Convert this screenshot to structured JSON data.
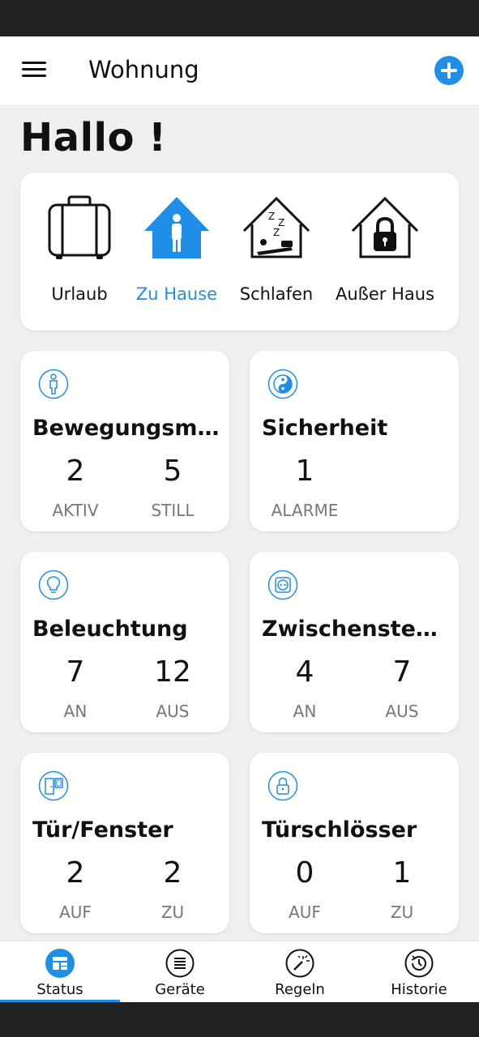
{
  "header": {
    "title": "Wohnung",
    "menu_icon": "hamburger-menu-icon",
    "add_icon": "plus-circle-icon",
    "accent_color": "#1f8ee6"
  },
  "greeting": "Hallo !",
  "modes": [
    {
      "label": "Urlaub",
      "icon": "suitcase-icon",
      "active": false
    },
    {
      "label": "Zu Hause",
      "icon": "home-person-icon",
      "active": true
    },
    {
      "label": "Schlafen",
      "icon": "sleep-house-icon",
      "active": false
    },
    {
      "label": "Außer Haus",
      "icon": "locked-house-icon",
      "active": false
    }
  ],
  "tiles": {
    "motion": {
      "title": "Bewegungsmel…",
      "icon": "person-icon",
      "values": [
        {
          "num": "2",
          "label": "AKTIV"
        },
        {
          "num": "5",
          "label": "STILL"
        }
      ]
    },
    "security": {
      "title": "Sicherheit",
      "icon": "yin-yang-icon",
      "values": [
        {
          "num": "1",
          "label": "ALARME"
        }
      ]
    },
    "lighting": {
      "title": "Beleuchtung",
      "icon": "lightbulb-icon",
      "values": [
        {
          "num": "7",
          "label": "AN"
        },
        {
          "num": "12",
          "label": "AUS"
        }
      ]
    },
    "plugs": {
      "title": "Zwischenstecker",
      "icon": "power-socket-icon",
      "values": [
        {
          "num": "4",
          "label": "AN"
        },
        {
          "num": "7",
          "label": "AUS"
        }
      ]
    },
    "doors": {
      "title": "Tür/Fenster",
      "icon": "door-window-icon",
      "values": [
        {
          "num": "2",
          "label": "AUF"
        },
        {
          "num": "2",
          "label": "ZU"
        }
      ]
    },
    "locks": {
      "title": "Türschlösser",
      "icon": "padlock-icon",
      "values": [
        {
          "num": "0",
          "label": "AUF"
        },
        {
          "num": "1",
          "label": "ZU"
        }
      ]
    }
  },
  "tabs": [
    {
      "label": "Status",
      "icon": "dashboard-icon",
      "active": true
    },
    {
      "label": "Geräte",
      "icon": "list-icon",
      "active": false
    },
    {
      "label": "Regeln",
      "icon": "magic-wand-icon",
      "active": false
    },
    {
      "label": "Historie",
      "icon": "history-icon",
      "active": false
    }
  ]
}
